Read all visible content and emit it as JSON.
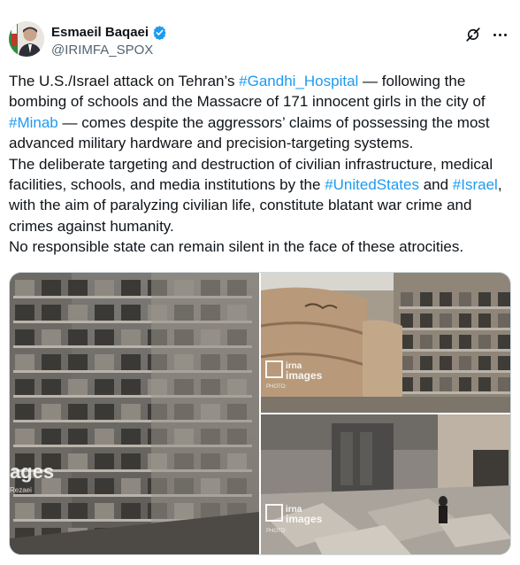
{
  "author": {
    "display_name": "Esmaeil Baqaei",
    "handle": "@IRIMFA_SPOX",
    "verified": true,
    "avatar_icon": "profile-photo"
  },
  "actions": {
    "grok_icon": "grok-icon",
    "more_icon": "more-options-icon"
  },
  "tweet": {
    "p1": {
      "t1": "The U.S./Israel attack on Tehran’s ",
      "h1": "#Gandhi_Hospital",
      "t2": " — following the bombing of schools and the Massacre of 171 innocent girls in the city of ",
      "h2": "#Minab",
      "t3": " — comes despite the aggressors’ claims of possessing the most advanced military hardware and precision-targeting systems."
    },
    "p2": {
      "t1": "The deliberate targeting and destruction of civilian infrastructure, medical facilities, schools, and media institutions by the ",
      "h1": "#UnitedStates",
      "t2": " and ",
      "h2": "#Israel",
      "t3": ", with the aim of paralyzing civilian life, constitute blatant war crime and crimes against humanity."
    },
    "p3": "No responsible state can remain silent in the face of these atrocities."
  },
  "media": {
    "watermark_left": "ages",
    "watermark_left_sub": "Rezaei",
    "watermark_brand": "irna",
    "watermark_brand2": "images",
    "watermark_photo": "PHOTO:"
  },
  "colors": {
    "link": "#1d9bf0",
    "text": "#0f1419",
    "muted": "#536471",
    "verified": "#1d9bf0"
  }
}
